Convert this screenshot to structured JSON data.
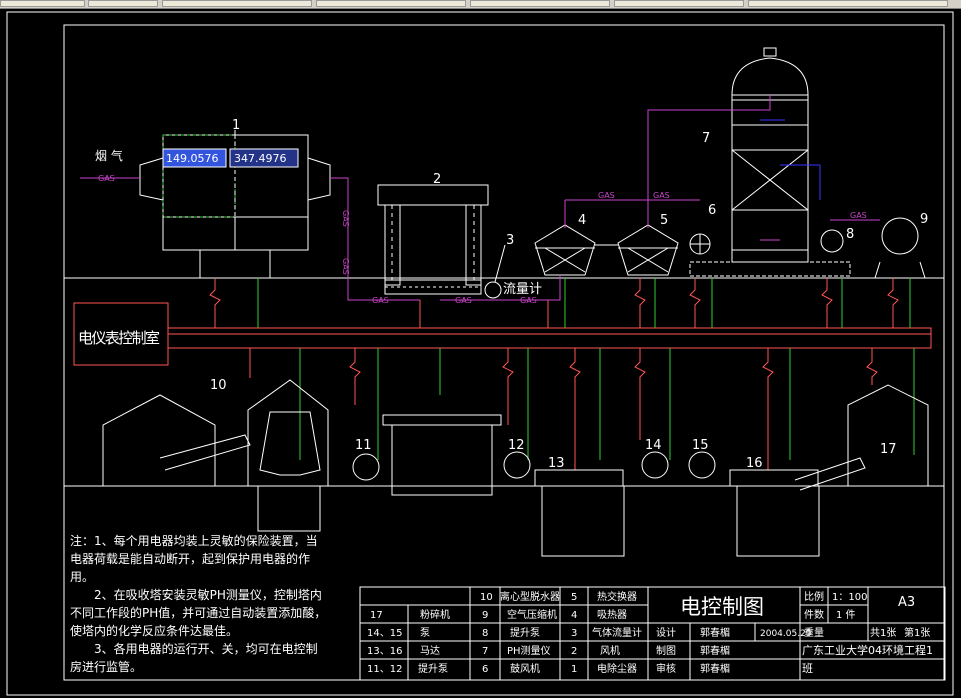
{
  "toolbar": {
    "buttons": [
      "",
      "",
      "",
      "",
      "",
      "",
      ""
    ]
  },
  "inputs": {
    "x_value": "149.0576",
    "y_value": "347.4976"
  },
  "labels": {
    "flue_gas": "烟 气",
    "gas": "GAS",
    "flowmeter": "流量计",
    "control_room": "电仪表控制室",
    "numbers": [
      "1",
      "2",
      "3",
      "4",
      "5",
      "6",
      "7",
      "8",
      "9",
      "10",
      "11",
      "12",
      "13",
      "14",
      "15",
      "16",
      "17"
    ]
  },
  "notes": [
    "注：1、每个用电器均装上灵敏的保险装置，当",
    "电器荷载是能自动断开，起到保护用电器的作",
    "用。",
    "2、在吸收塔安装灵敏PH测量仪，控制塔内",
    "不同工作段的PH值，并可通过自动装置添加酸，",
    "使塔内的化学反应条件达最佳。",
    "3、各用电器的运行开、关，均可在电控制",
    "房进行监管。"
  ],
  "parts_table": {
    "rows": [
      [
        "",
        "",
        "10",
        "离心型脱水器",
        "5",
        "热交换器"
      ],
      [
        "17",
        "粉碎机",
        "9",
        "空气压缩机",
        "4",
        "吸热器"
      ],
      [
        "14、15",
        "泵",
        "8",
        "提升泵",
        "3",
        "气体流量计"
      ],
      [
        "13、16",
        "马达",
        "7",
        "PH测量仪",
        "2",
        "风机"
      ],
      [
        "11、12",
        "提升泵",
        "6",
        "鼓风机",
        "1",
        "电除尘器"
      ]
    ]
  },
  "title_block": {
    "title": "电控制图",
    "scale_label": "比例",
    "scale_value": "1：100",
    "count_label": "件数",
    "count_value": "1 件",
    "size": "A3",
    "design_label": "设计",
    "designer": "郭春楣",
    "date": "2004.05.29",
    "weight_label": "重量",
    "sheets": "共1张",
    "sheet_no": "第1张",
    "draw_label": "制图",
    "drafter": "郭春楣",
    "review_label": "审核",
    "reviewer": "郭春楣",
    "school": "广东工业大学04环境工程1",
    "class_suffix": "班"
  },
  "colors": {
    "background": "#000000",
    "line": "#ffffff",
    "gas_pipe": "#cc44cc",
    "power_bus": "#ff5555",
    "signal": "#33cc33",
    "water": "#3333ff",
    "input_selected_bg": "#3355dd",
    "input_bg": "#223388"
  }
}
